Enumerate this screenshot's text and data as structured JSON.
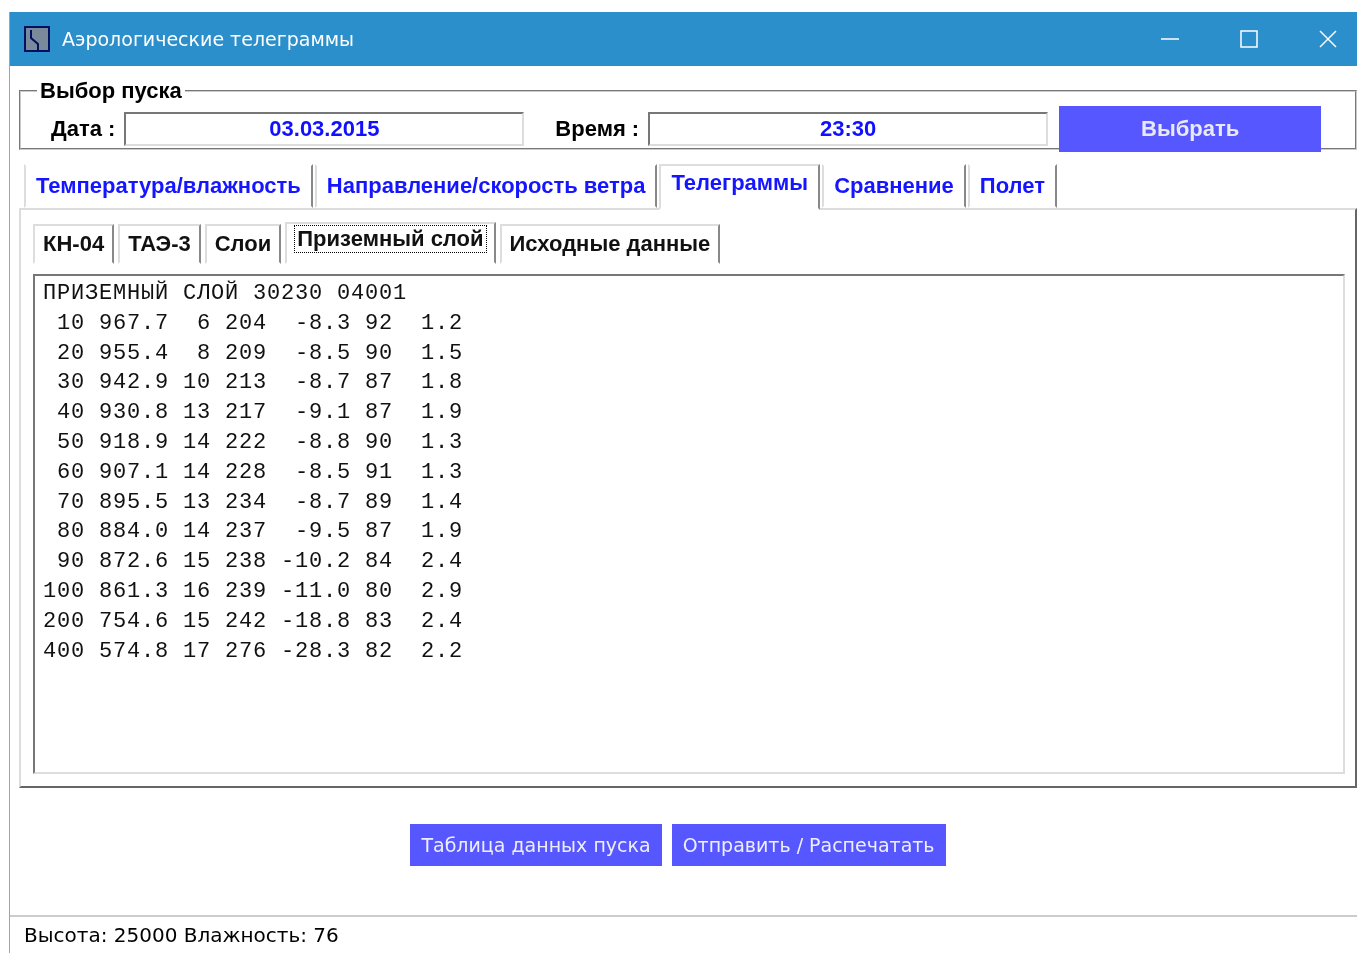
{
  "window": {
    "title": "Аэрологические телеграммы"
  },
  "launch_selection": {
    "title": "Выбор пуска",
    "date_label": "Дата :",
    "date_value": "03.03.2015",
    "time_label": "Время :",
    "time_value": "23:30",
    "select_button": "Выбрать"
  },
  "tabs": [
    {
      "label": "Температура/влажность",
      "selected": false
    },
    {
      "label": "Направление/скорость ветра",
      "selected": false
    },
    {
      "label": "Телеграммы",
      "selected": true
    },
    {
      "label": "Сравнение",
      "selected": false
    },
    {
      "label": "Полет",
      "selected": false
    }
  ],
  "subtabs": [
    {
      "label": "КН-04",
      "selected": false
    },
    {
      "label": "ТАЭ-3",
      "selected": false
    },
    {
      "label": "Слои",
      "selected": false
    },
    {
      "label": "Приземный слой",
      "selected": true
    },
    {
      "label": "Исходные данные",
      "selected": false
    }
  ],
  "text_lines": [
    "ПРИЗЕМНЫЙ СЛОЙ 30230 04001",
    " 10 967.7  6 204  -8.3 92  1.2",
    " 20 955.4  8 209  -8.5 90  1.5",
    " 30 942.9 10 213  -8.7 87  1.8",
    " 40 930.8 13 217  -9.1 87  1.9",
    " 50 918.9 14 222  -8.8 90  1.3",
    " 60 907.1 14 228  -8.5 91  1.3",
    " 70 895.5 13 234  -8.7 89  1.4",
    " 80 884.0 14 237  -9.5 87  1.9",
    " 90 872.6 15 238 -10.2 84  2.4",
    "100 861.3 16 239 -11.0 80  2.9",
    "200 754.6 15 242 -18.8 83  2.4",
    "400 574.8 17 276 -28.3 82  2.2"
  ],
  "buttons": [
    "Таблица данных пуска",
    "Отправить / Распечатать"
  ],
  "status_bar": "Высота: 25000 Влажность: 76"
}
